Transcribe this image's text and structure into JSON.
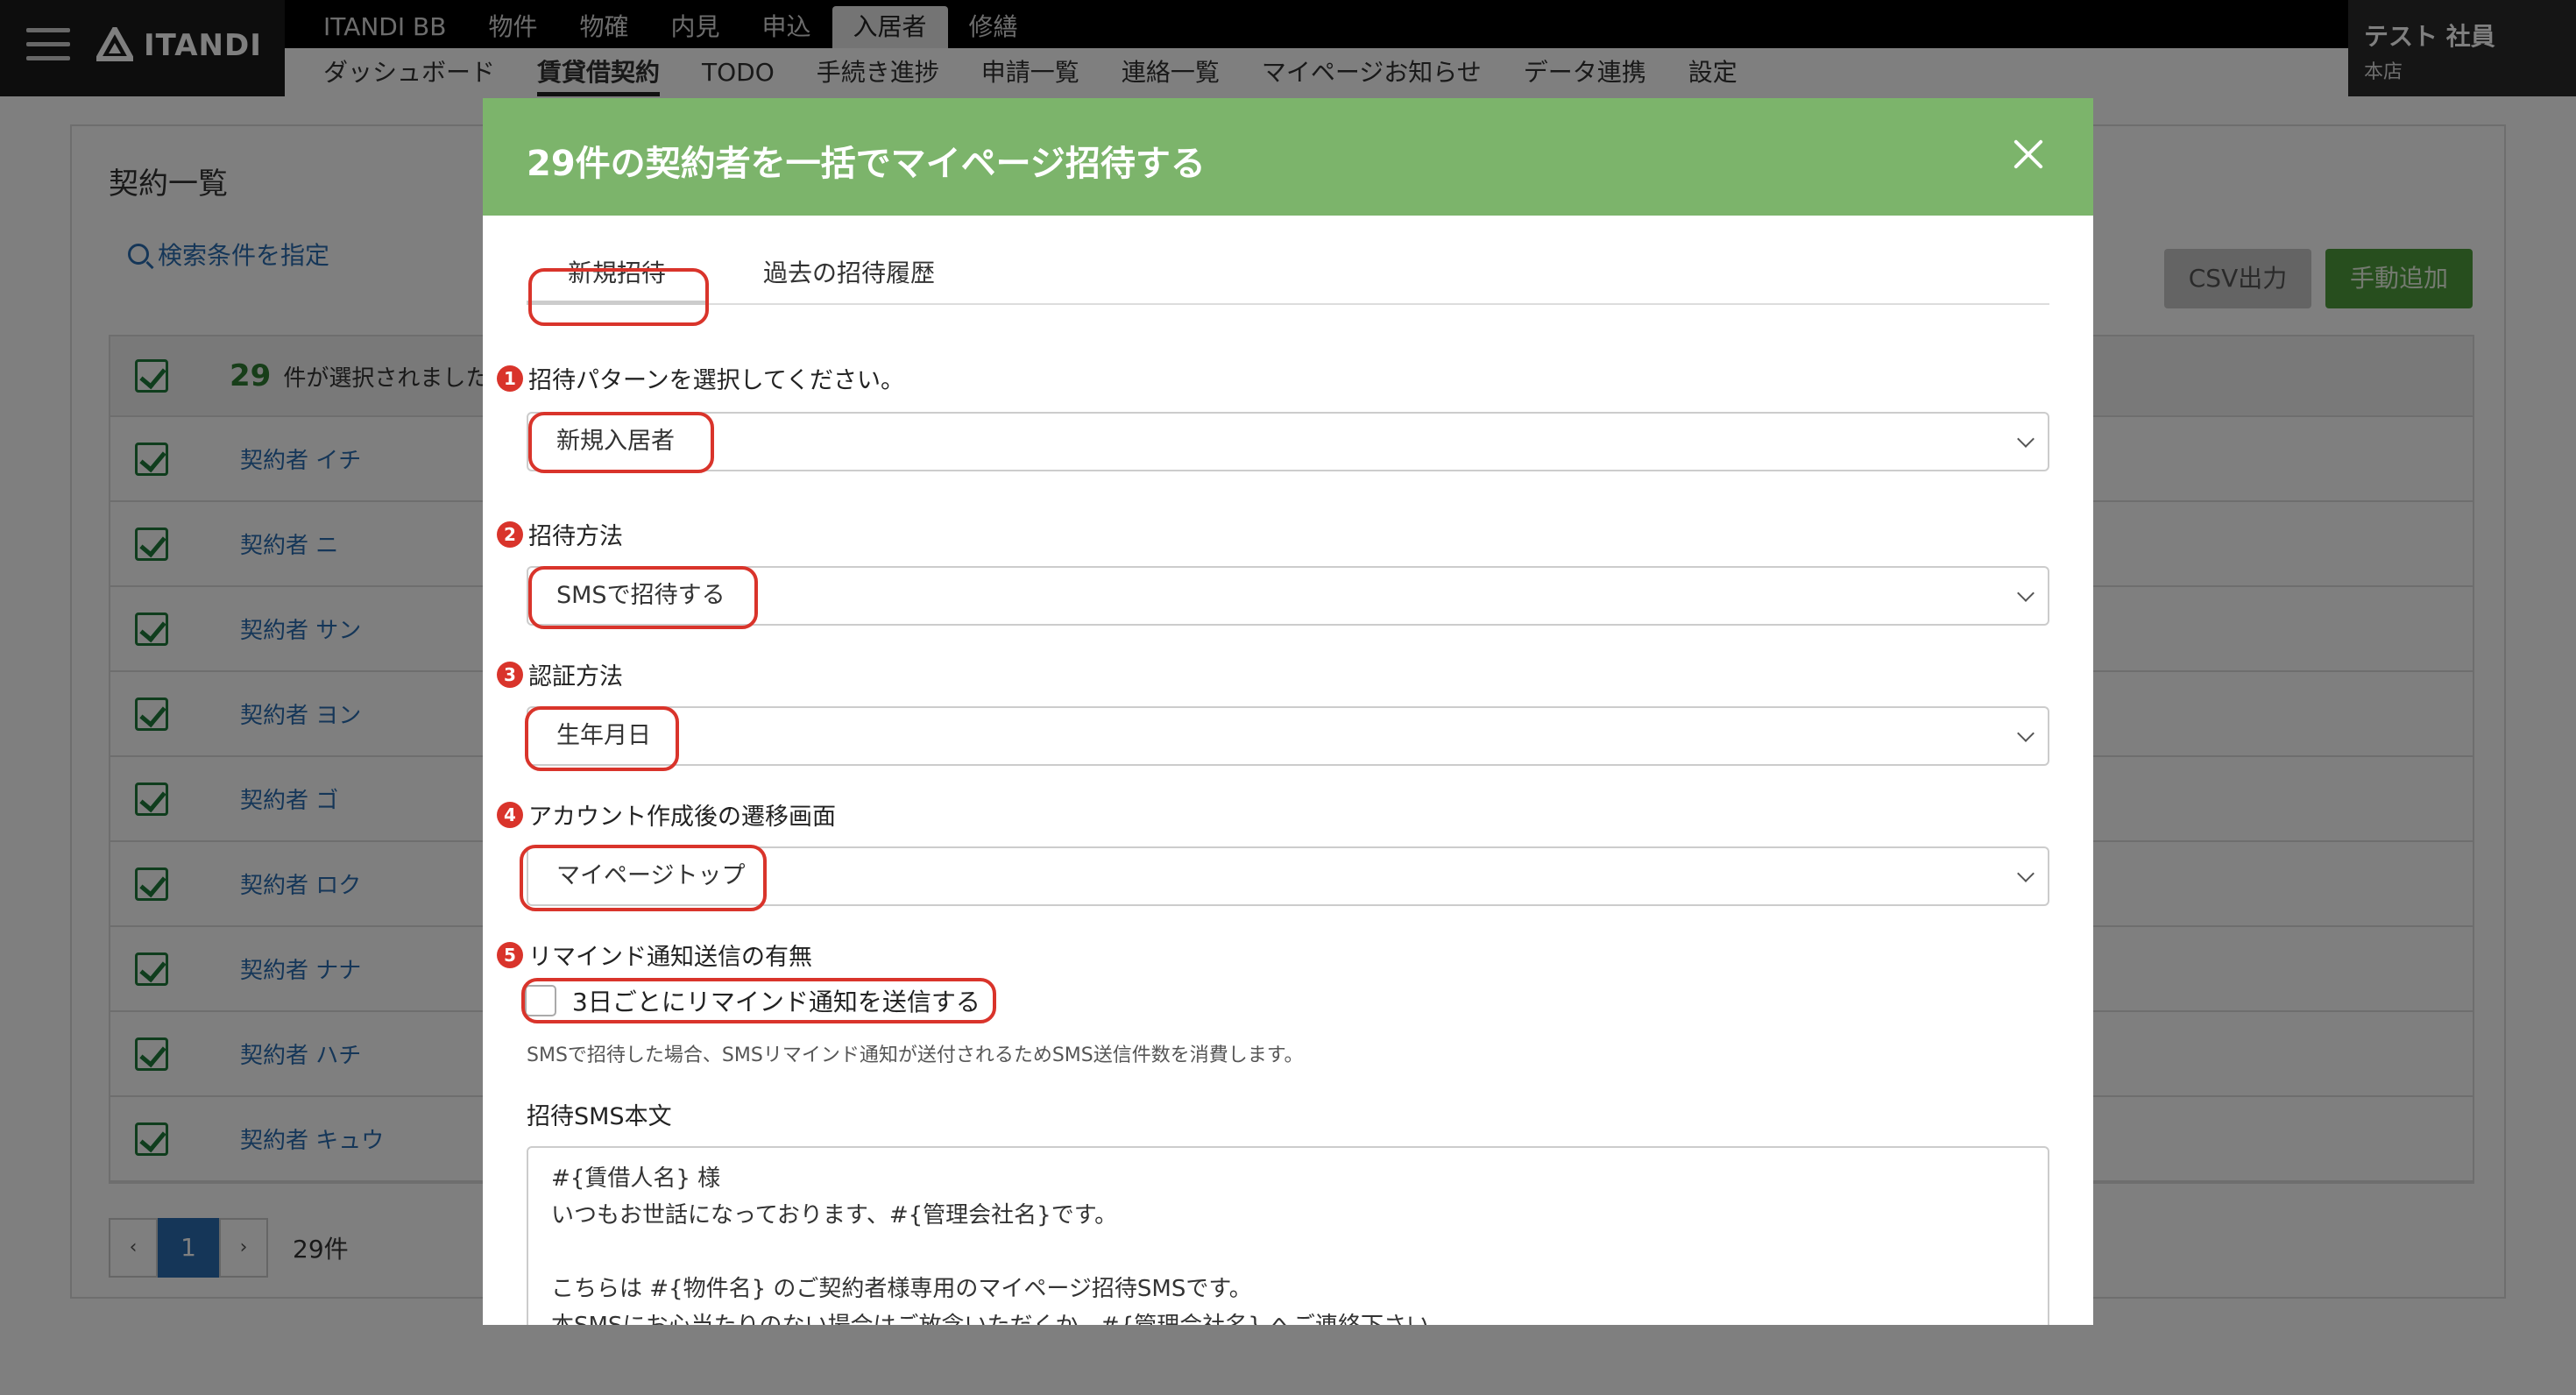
{
  "topbar": {
    "logo_text": "ITANDI",
    "nav_main": [
      "ITANDI BB",
      "物件",
      "物確",
      "内見",
      "申込",
      "入居者",
      "修繕"
    ],
    "nav_main_active": "入居者",
    "nav_sub": [
      "ダッシュボード",
      "賃貸借契約",
      "TODO",
      "手続き進捗",
      "申請一覧",
      "連絡一覧",
      "マイページお知らせ",
      "データ連携",
      "設定"
    ],
    "nav_sub_active": "賃貸借契約",
    "user_name": "テスト 社員",
    "user_branch": "本店"
  },
  "background_page": {
    "title": "契約一覧",
    "search_link": "検索条件を指定",
    "csv_button": "CSV出力",
    "add_button": "手動追加",
    "selected_count": "29",
    "selected_text": "件が選択されました",
    "rows": [
      "契約者 イチ",
      "契約者 ニ",
      "契約者 サン",
      "契約者 ヨン",
      "契約者 ゴ",
      "契約者 ロク",
      "契約者 ナナ",
      "契約者 ハチ",
      "契約者 キュウ"
    ],
    "pager": {
      "prev": "‹",
      "current": "1",
      "next": "›",
      "total": "29件"
    }
  },
  "modal": {
    "title": "29件の契約者を一括でマイページ招待する",
    "tabs": {
      "new": "新規招待",
      "history": "過去の招待履歴"
    },
    "sections": [
      {
        "num": "1",
        "label": "招待パターンを選択してください。",
        "value": "新規入居者"
      },
      {
        "num": "2",
        "label": "招待方法",
        "value": "SMSで招待する"
      },
      {
        "num": "3",
        "label": "認証方法",
        "value": "生年月日"
      },
      {
        "num": "4",
        "label": "アカウント作成後の遷移画面",
        "value": "マイページトップ"
      },
      {
        "num": "5",
        "label": "リマインド通知送信の有無"
      }
    ],
    "remind_checkbox_label": "3日ごとにリマインド通知を送信する",
    "remind_checked": false,
    "note": "SMSで招待した場合、SMSリマインド通知が送付されるためSMS送信件数を消費します。",
    "sms_body_label": "招待SMS本文",
    "sms_body": "#{賃借人名} 様\nいつもお世話になっております、#{管理会社名}です。\n\nこちらは #{物件名} のご契約者様専用のマイページ招待SMSです。\n本SMSにお心当たりのない場合はご放念いただくか、#{管理会社名} へご連絡下さい。"
  },
  "colors": {
    "header_green": "#7cb46b",
    "highlight_red": "#d9342b",
    "link_blue": "#2a6db0",
    "check_green": "#1e7a3a",
    "add_button_green": "#4e9c3c"
  }
}
